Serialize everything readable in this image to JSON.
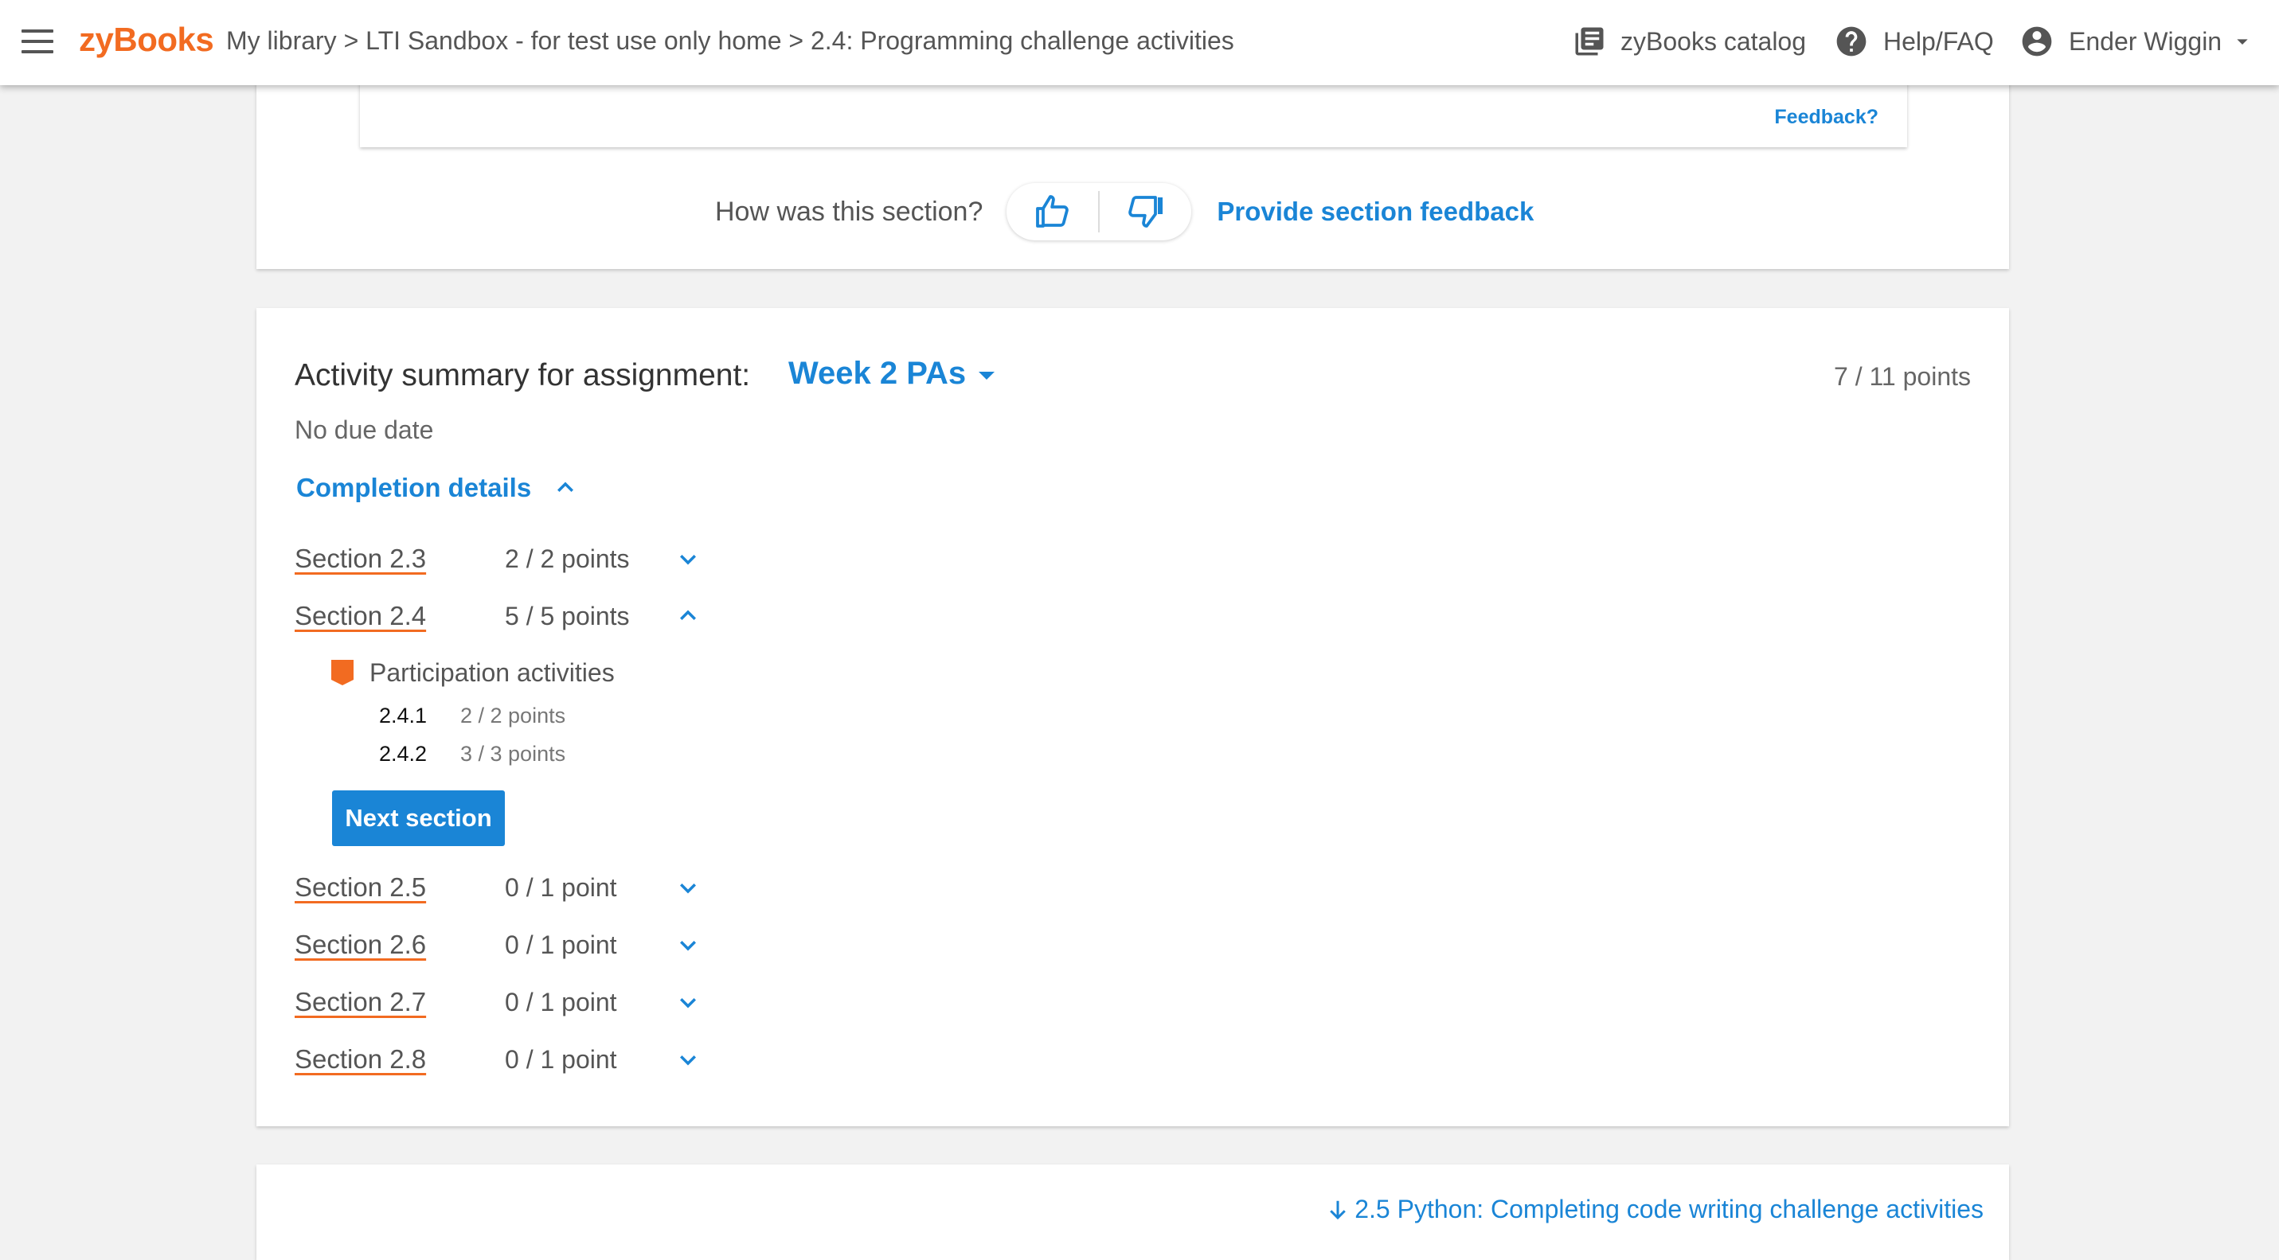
{
  "topbar": {
    "logo": "zyBooks",
    "breadcrumb": [
      {
        "label": "My library"
      },
      {
        "label": "LTI Sandbox - for test use only home"
      },
      {
        "label": "2.4: Programming challenge activities"
      }
    ],
    "separator": ">",
    "catalog_label": "zyBooks catalog",
    "help_label": "Help/FAQ",
    "user_name": "Ender Wiggin"
  },
  "previous_content": {
    "feedback_link": "Feedback?"
  },
  "section_rating": {
    "question": "How was this section?",
    "provide_feedback": "Provide section feedback"
  },
  "summary": {
    "title": "Activity summary for assignment:",
    "assignment_name": "Week 2 PAs",
    "total_points": "7 / 11 points",
    "due_date": "No due date",
    "completion_toggle": "Completion details",
    "sections": [
      {
        "label": "Section 2.3",
        "points": "2 / 2 points",
        "expanded": false
      },
      {
        "label": "Section 2.4",
        "points": "5 / 5 points",
        "expanded": true
      },
      {
        "label": "Section 2.5",
        "points": "0 / 1 point",
        "expanded": false
      },
      {
        "label": "Section 2.6",
        "points": "0 / 1 point",
        "expanded": false
      },
      {
        "label": "Section 2.7",
        "points": "0 / 1 point",
        "expanded": false
      },
      {
        "label": "Section 2.8",
        "points": "0 / 1 point",
        "expanded": false
      }
    ],
    "expanded_detail": {
      "group_label": "Participation activities",
      "activities": [
        {
          "number": "2.4.1",
          "points": "2 / 2 points"
        },
        {
          "number": "2.4.2",
          "points": "3 / 3 points"
        }
      ],
      "next_button": "Next section"
    }
  },
  "next_chapter": {
    "label": "2.5 Python: Completing code writing challenge activities"
  },
  "colors": {
    "brand_orange": "#f26b21",
    "link_blue": "#1a85d6",
    "page_background": "#f2f2f2"
  },
  "icons": [
    "hamburger-icon",
    "catalog-icon",
    "help-icon",
    "account-icon",
    "dropdown-caret-icon",
    "thumbs-up-icon",
    "thumbs-down-icon",
    "chevron-up-icon",
    "chevron-down-icon",
    "participation-activity-icon",
    "arrow-down-icon"
  ]
}
